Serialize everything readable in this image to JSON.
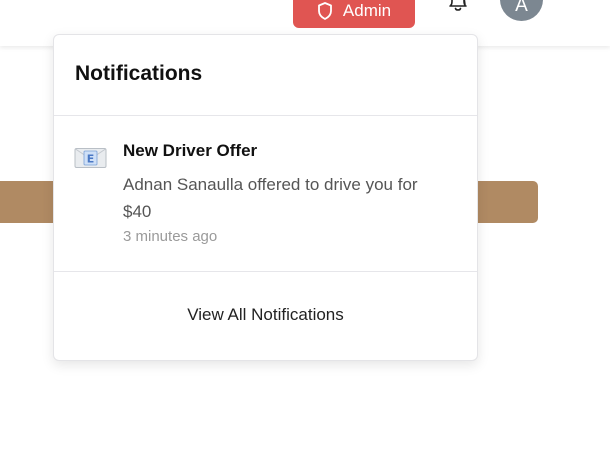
{
  "header": {
    "admin_label": "Admin",
    "avatar_initial": "A"
  },
  "notifications": {
    "title": "Notifications",
    "items": [
      {
        "title": "New Driver Offer",
        "body": "Adnan Sanaulla offered to drive you for $40",
        "time": "3 minutes ago",
        "icon": "envelope-icon"
      }
    ],
    "view_all_label": "View All Notifications"
  },
  "colors": {
    "admin_button": "#e05552",
    "avatar": "#7c8791",
    "background_bar": "#b08a63"
  }
}
